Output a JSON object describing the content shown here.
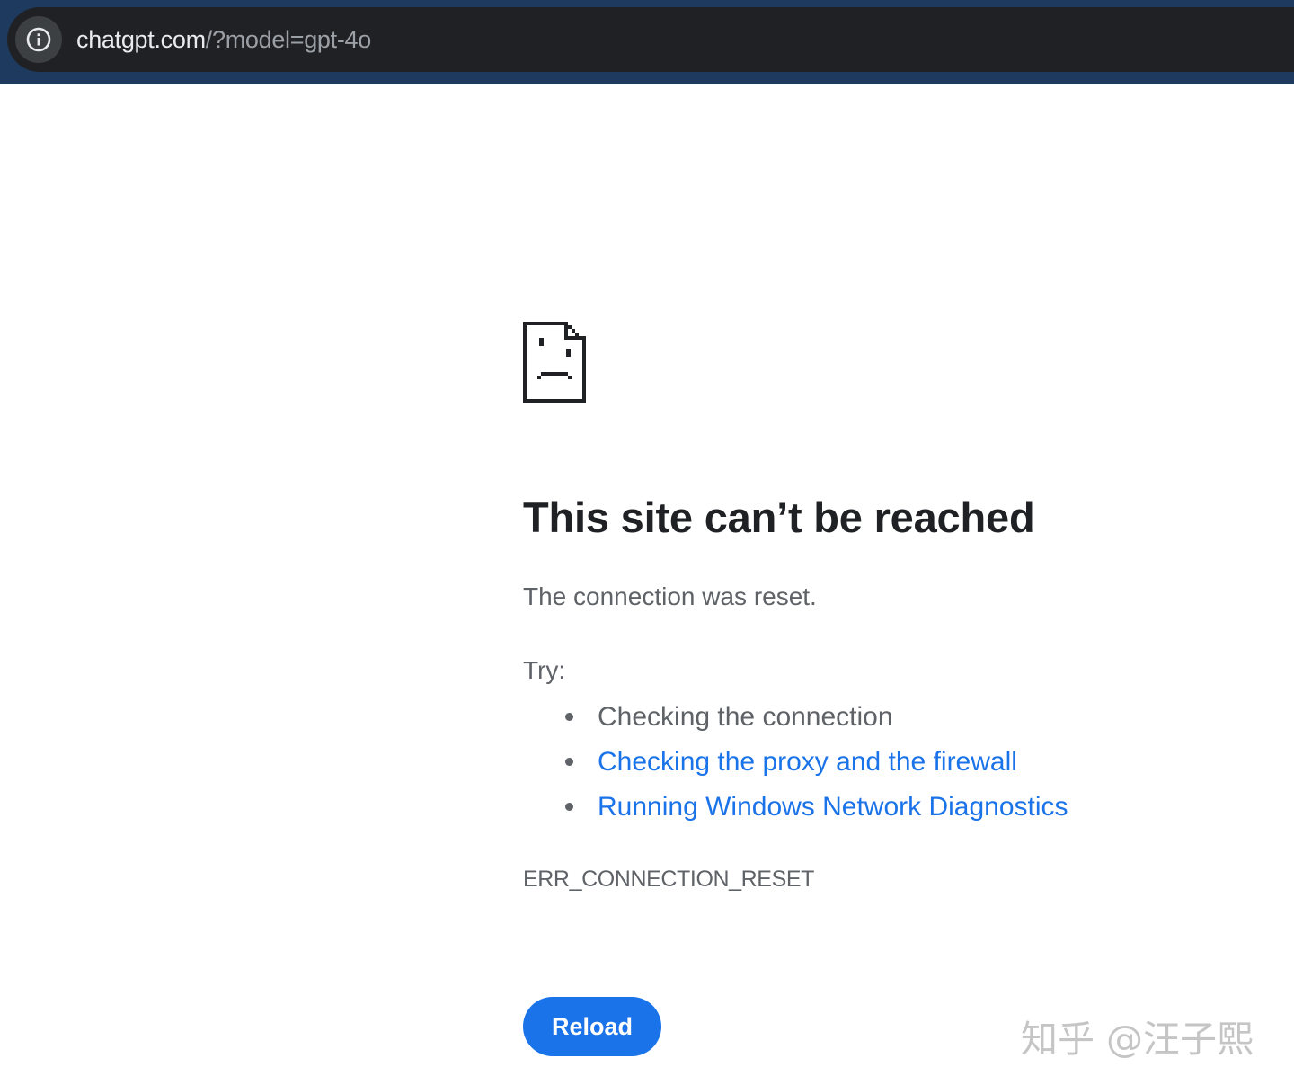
{
  "address_bar": {
    "site_info_icon": "info-circle-icon",
    "url_host": "chatgpt.com",
    "url_path": "/?model=gpt-4o"
  },
  "error_page": {
    "icon": "sad-page-icon",
    "title": "This site can’t be reached",
    "description": "The connection was reset.",
    "try_label": "Try:",
    "suggestions": [
      {
        "label": "Checking the connection",
        "is_link": false
      },
      {
        "label": "Checking the proxy and the firewall",
        "is_link": true
      },
      {
        "label": "Running Windows Network Diagnostics",
        "is_link": true
      }
    ],
    "error_code": "ERR_CONNECTION_RESET",
    "reload_label": "Reload"
  },
  "watermark": "知乎 @汪子熙",
  "colors": {
    "toolbar": "#1e3a5f",
    "omnibox": "#202124",
    "link": "#1a73e8",
    "button": "#1a73e8",
    "title": "#202124",
    "body_text": "#5f6368"
  }
}
